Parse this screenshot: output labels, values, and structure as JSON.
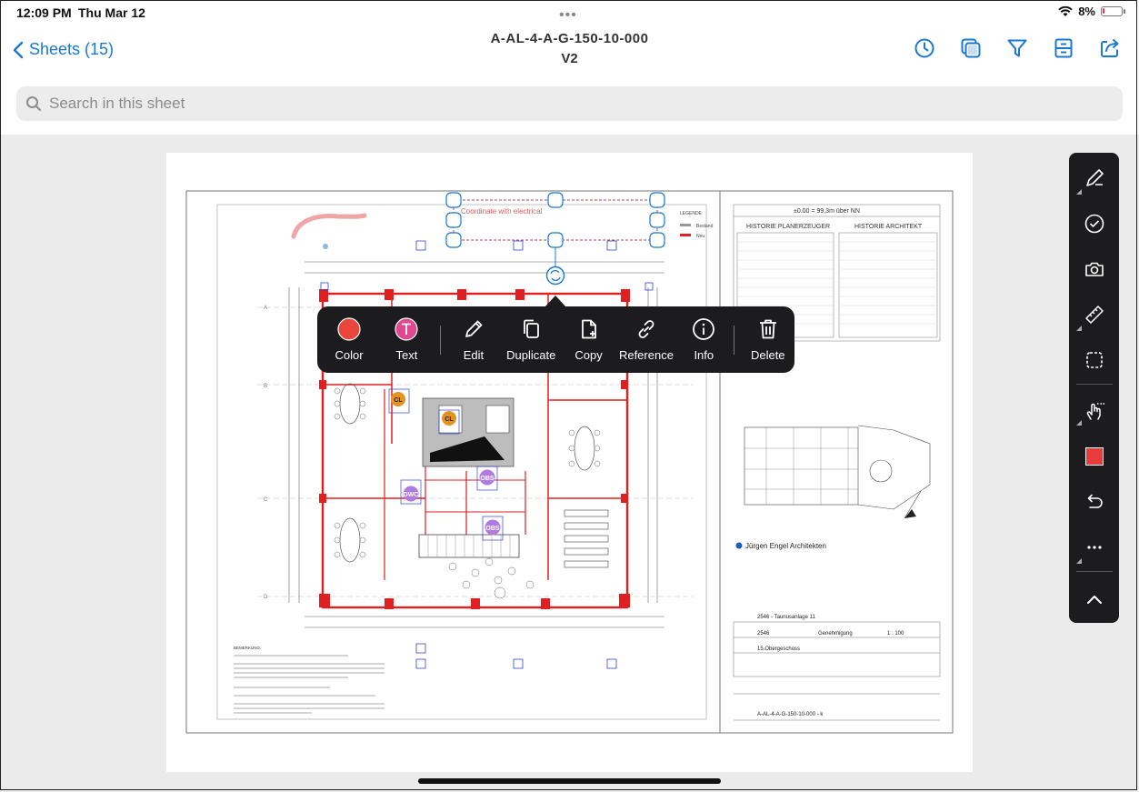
{
  "status": {
    "time": "12:09 PM",
    "date": "Thu Mar 12",
    "battery": "8%",
    "battery_level": 0.08,
    "dots": "•••"
  },
  "nav": {
    "back_label": "Sheets (15)",
    "title": "A-AL-4-A-G-150-10-000",
    "version": "V2",
    "icons": [
      "clock-icon",
      "layers-icon",
      "filter-icon",
      "drawer-icon",
      "share-icon"
    ]
  },
  "search": {
    "placeholder": "Search in this sheet"
  },
  "sheet": {
    "annotation_text": "Coordinate with electrical",
    "legend": {
      "title": "LEGENDE:",
      "bestand": "Bestand",
      "neu": "Neu"
    },
    "elevation": "±0.00 = 99,3m über NN",
    "history_left": "HISTORIE PLANERZEUGER",
    "history_right": "HISTORIE ARCHITEKT",
    "architect": "Jürgen Engel Architekten",
    "project": "2546 - Taunusanlage 11",
    "project_no": "2546",
    "phase": "Genehmigung",
    "scale": "1 : 100",
    "floor": "15.Obergeschoss",
    "plan_no": "A-AL-4-A-G-150-10-000 - k",
    "tags": {
      "cl": "CL",
      "dwc": "DWC",
      "obs": "OBS"
    },
    "remarks_title": "BEMERKUNG:"
  },
  "popup": {
    "items": [
      {
        "label": "Color",
        "icon": "color-swatch-icon"
      },
      {
        "label": "Text",
        "icon": "text-color-icon"
      },
      {
        "label": "Edit",
        "icon": "pencil-icon"
      },
      {
        "label": "Duplicate",
        "icon": "duplicate-icon"
      },
      {
        "label": "Copy",
        "icon": "copy-icon"
      },
      {
        "label": "Reference",
        "icon": "link-icon"
      },
      {
        "label": "Info",
        "icon": "info-icon"
      },
      {
        "label": "Delete",
        "icon": "trash-icon"
      }
    ],
    "colors": {
      "swatch": "#e8453c",
      "text": "#e0488f"
    }
  },
  "toolbar": {
    "tools": [
      "pen-icon",
      "checkmark-circle-icon",
      "camera-icon",
      "ruler-icon",
      "lasso-icon",
      "hand-icon",
      "color-square-icon",
      "undo-icon",
      "more-icon",
      "collapse-icon"
    ],
    "active_color": "#e83c3c"
  },
  "colors": {
    "accent": "#1a78d0",
    "markup_red": "#e02020"
  }
}
